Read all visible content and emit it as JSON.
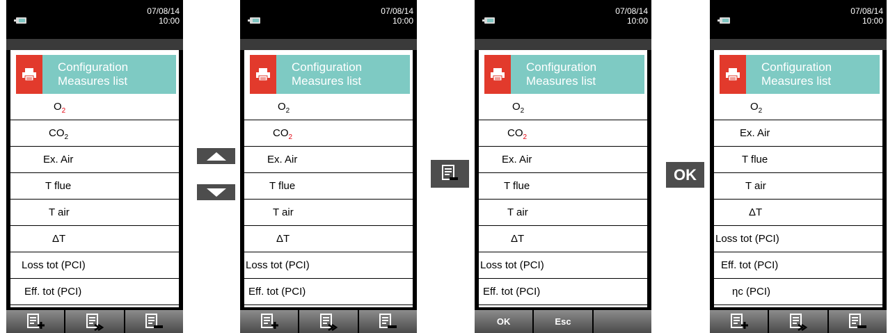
{
  "screens": [
    {
      "date": "07/08/14",
      "time": "10:00",
      "header": {
        "line1": "Configuration",
        "line2": "Measures list"
      },
      "rows": [
        {
          "text": "O",
          "sub": "2",
          "selected": true,
          "indent": 62
        },
        {
          "text": "CO",
          "sub": "2",
          "selected": false,
          "indent": 55
        },
        {
          "text": "Ex. Air",
          "selected": false,
          "indent": 47
        },
        {
          "text": "T flue",
          "selected": false,
          "indent": 50
        },
        {
          "text": "T air",
          "selected": false,
          "indent": 55
        },
        {
          "text": "ΔT",
          "selected": false,
          "indent": 60
        },
        {
          "text": "Loss tot (PCI)",
          "selected": false,
          "indent": 16
        },
        {
          "text": "Eff. tot (PCI)",
          "selected": false,
          "indent": 20
        }
      ],
      "softkeys": [
        {
          "icon": "list-add-icon"
        },
        {
          "icon": "list-insert-icon"
        },
        {
          "icon": "list-remove-icon"
        }
      ]
    },
    {
      "date": "07/08/14",
      "time": "10:00",
      "header": {
        "line1": "Configuration",
        "line2": "Measures list"
      },
      "rows": [
        {
          "text": "O",
          "sub": "2",
          "selected": false,
          "indent": 48
        },
        {
          "text": "CO",
          "sub": "2",
          "selected": true,
          "indent": 41
        },
        {
          "text": "Ex. Air",
          "selected": false,
          "indent": 33
        },
        {
          "text": "T flue",
          "selected": false,
          "indent": 36
        },
        {
          "text": "T air",
          "selected": false,
          "indent": 41
        },
        {
          "text": "ΔT",
          "selected": false,
          "indent": 46
        },
        {
          "text": "Loss tot (PCI)",
          "selected": false,
          "indent": 2
        },
        {
          "text": "Eff. tot (PCI)",
          "selected": false,
          "indent": 6
        }
      ],
      "softkeys": [
        {
          "icon": "list-add-icon"
        },
        {
          "icon": "list-insert-icon"
        },
        {
          "icon": "list-remove-icon"
        }
      ]
    },
    {
      "date": "07/08/14",
      "time": "10:00",
      "header": {
        "line1": "Configuration",
        "line2": "Measures list"
      },
      "rows": [
        {
          "text": "O",
          "sub": "2",
          "selected": false,
          "indent": 48
        },
        {
          "text": "CO",
          "sub": "2",
          "selected": true,
          "indent": 41
        },
        {
          "text": "Ex. Air",
          "selected": false,
          "indent": 33
        },
        {
          "text": "T flue",
          "selected": false,
          "indent": 36
        },
        {
          "text": "T air",
          "selected": false,
          "indent": 41
        },
        {
          "text": "ΔT",
          "selected": false,
          "indent": 46
        },
        {
          "text": "Loss tot (PCI)",
          "selected": false,
          "indent": 2
        },
        {
          "text": "Eff. tot (PCI)",
          "selected": false,
          "indent": 6
        }
      ],
      "softkeys": [
        {
          "label": "OK"
        },
        {
          "label": "Esc"
        },
        {
          "label": ""
        }
      ]
    },
    {
      "date": "07/08/14",
      "time": "10:00",
      "header": {
        "line1": "Configuration",
        "line2": "Measures list"
      },
      "rows": [
        {
          "text": "O",
          "sub": "2",
          "selected": false,
          "indent": 52
        },
        {
          "text": "Ex. Air",
          "selected": true,
          "indent": 37
        },
        {
          "text": "T flue",
          "selected": false,
          "indent": 40
        },
        {
          "text": "T air",
          "selected": false,
          "indent": 45
        },
        {
          "text": "ΔT",
          "selected": false,
          "indent": 50
        },
        {
          "text": "Loss tot (PCI)",
          "selected": false,
          "indent": 2
        },
        {
          "text": "Eff. tot (PCI)",
          "selected": false,
          "indent": 10
        },
        {
          "text": "ηc (PCI)",
          "selected": false,
          "indent": 26
        }
      ],
      "softkeys": [
        {
          "icon": "list-add-icon"
        },
        {
          "icon": "list-insert-icon"
        },
        {
          "icon": "list-remove-icon"
        }
      ]
    }
  ],
  "keys": {
    "up": {
      "icon": "arrow-up-icon"
    },
    "down": {
      "icon": "arrow-down-icon"
    },
    "remove": {
      "icon": "list-remove-icon"
    },
    "ok": {
      "label": "OK"
    }
  },
  "colors": {
    "header": "#7ecac3",
    "icon_bg": "#e23a2c",
    "selected": "#e30613"
  }
}
